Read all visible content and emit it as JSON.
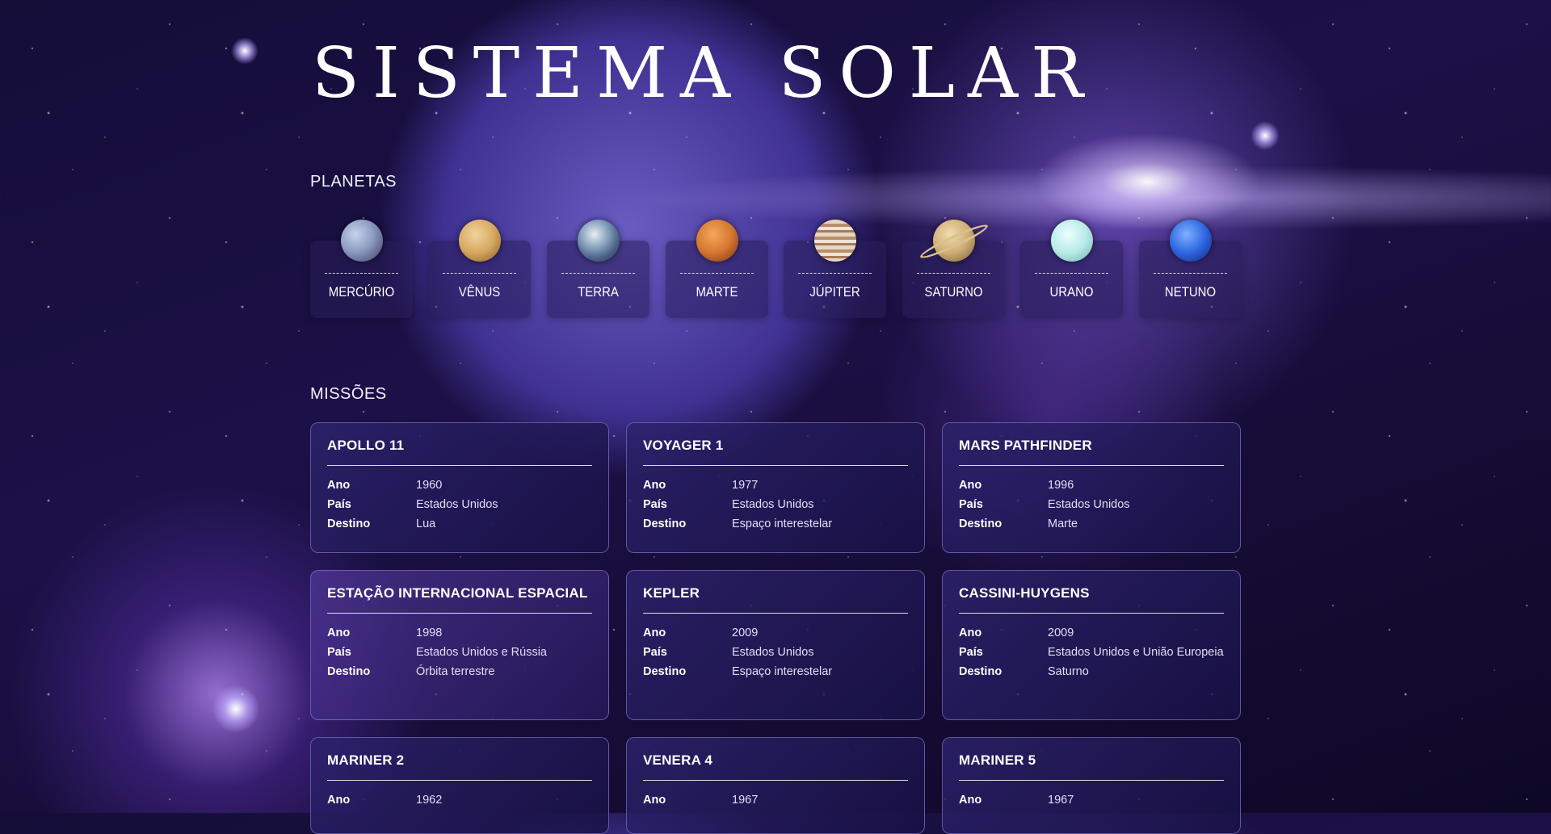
{
  "header": {
    "title": "SISTEMA SOLAR"
  },
  "sections": {
    "planets": "PLANETAS",
    "missions": "MISSÕES"
  },
  "planets": [
    {
      "name": "MERCÚRIO",
      "icon": "mercury-icon"
    },
    {
      "name": "VÊNUS",
      "icon": "venus-icon"
    },
    {
      "name": "TERRA",
      "icon": "earth-icon"
    },
    {
      "name": "MARTE",
      "icon": "mars-icon"
    },
    {
      "name": "JÚPITER",
      "icon": "jupiter-icon"
    },
    {
      "name": "SATURNO",
      "icon": "saturn-icon"
    },
    {
      "name": "URANO",
      "icon": "uranus-icon"
    },
    {
      "name": "NETUNO",
      "icon": "neptune-icon"
    }
  ],
  "labels": {
    "year": "Ano",
    "country": "País",
    "destination": "Destino"
  },
  "missions": [
    {
      "name": "APOLLO 11",
      "year": "1960",
      "country": "Estados Unidos",
      "destination": "Lua"
    },
    {
      "name": "VOYAGER 1",
      "year": "1977",
      "country": "Estados Unidos",
      "destination": "Espaço interestelar"
    },
    {
      "name": "MARS PATHFINDER",
      "year": "1996",
      "country": "Estados Unidos",
      "destination": "Marte"
    },
    {
      "name": "ESTAÇÃO INTERNACIONAL ESPACIAL",
      "year": "1998",
      "country": "Estados Unidos e Rússia",
      "destination": "Órbita terrestre"
    },
    {
      "name": "KEPLER",
      "year": "2009",
      "country": "Estados Unidos",
      "destination": "Espaço interestelar"
    },
    {
      "name": "CASSINI-HUYGENS",
      "year": "2009",
      "country": "Estados Unidos e União Europeia",
      "destination": "Saturno"
    },
    {
      "name": "MARINER 2",
      "year": "1962",
      "country": "",
      "destination": ""
    },
    {
      "name": "VENERA 4",
      "year": "1967",
      "country": "",
      "destination": ""
    },
    {
      "name": "MARINER 5",
      "year": "1967",
      "country": "",
      "destination": ""
    }
  ]
}
